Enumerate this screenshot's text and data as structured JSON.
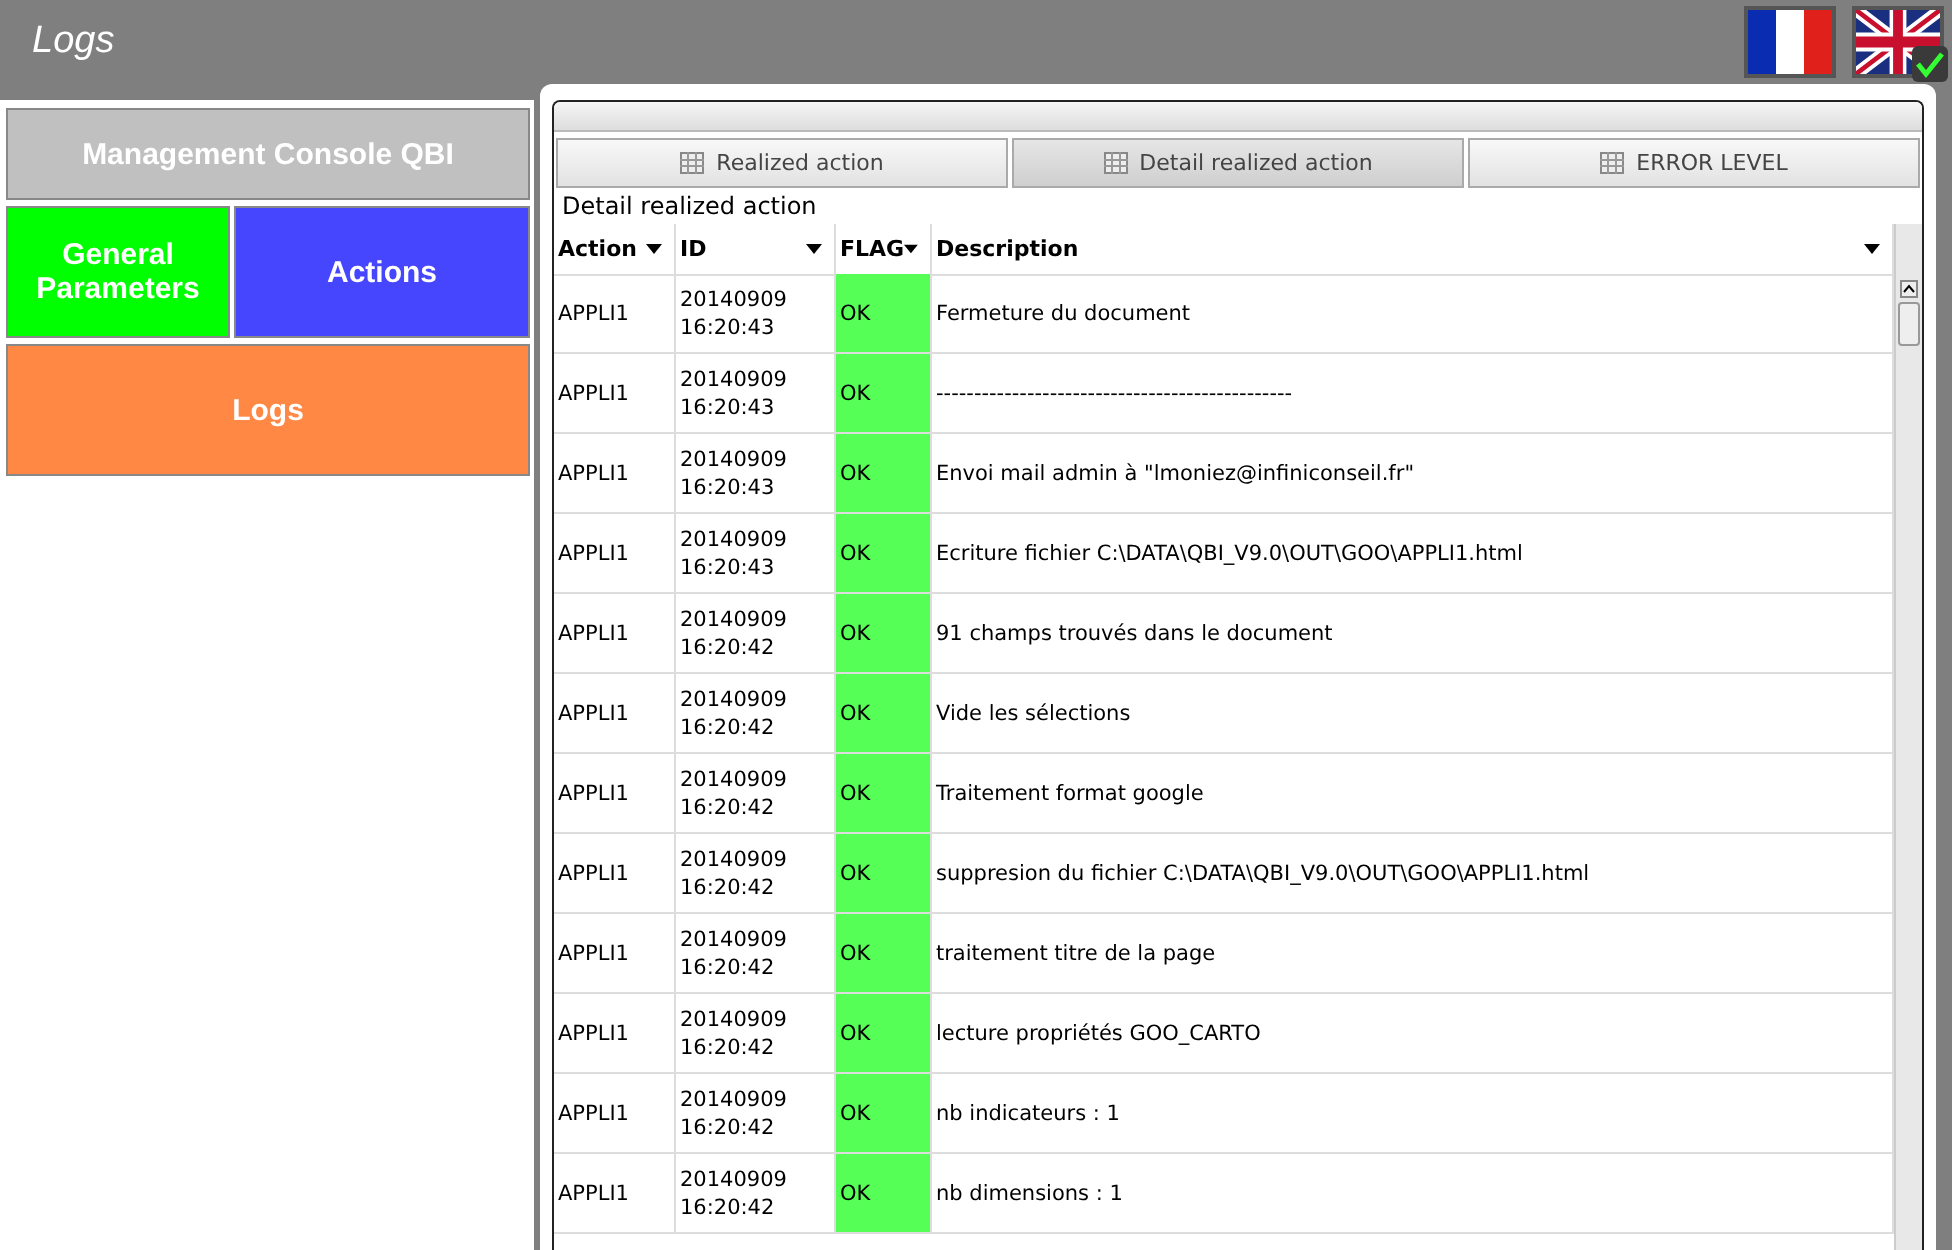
{
  "window": {
    "title": "Logs"
  },
  "languages": [
    {
      "kind": "france",
      "selected": false
    },
    {
      "kind": "uk",
      "selected": true
    }
  ],
  "nav": [
    {
      "label": "Management Console QBI",
      "color": "#c0c0c0",
      "kind": "wide"
    },
    {
      "label": "General Parameters",
      "color": "#00ff00",
      "kind": "half"
    },
    {
      "label": "Actions",
      "color": "#4646ff",
      "kind": "half"
    },
    {
      "label": "Logs",
      "color": "#ff8844",
      "kind": "wide"
    }
  ],
  "tabs": [
    {
      "label": "Realized action",
      "selected": false
    },
    {
      "label": "Detail realized action",
      "selected": true
    },
    {
      "label": "ERROR LEVEL",
      "selected": false
    }
  ],
  "table": {
    "caption": "Detail realized action",
    "columns": [
      "Action",
      "ID",
      "FLAG",
      "Description"
    ],
    "rows": [
      {
        "action": "APPLI1",
        "id": "20140909\n16:20:43",
        "flag": "OK",
        "color": "#55ff55",
        "description": "Fermeture du document"
      },
      {
        "action": "APPLI1",
        "id": "20140909\n16:20:43",
        "flag": "OK",
        "color": "#55ff55",
        "description": "-----------------------------------------------"
      },
      {
        "action": "APPLI1",
        "id": "20140909\n16:20:43",
        "flag": "OK",
        "color": "#55ff55",
        "description": "Envoi mail admin à \"lmoniez@infiniconseil.fr\""
      },
      {
        "action": "APPLI1",
        "id": "20140909\n16:20:43",
        "flag": "OK",
        "color": "#55ff55",
        "description": "Ecriture fichier C:\\DATA\\QBI_V9.0\\OUT\\GOO\\APPLI1.html"
      },
      {
        "action": "APPLI1",
        "id": "20140909\n16:20:42",
        "flag": "OK",
        "color": "#55ff55",
        "description": "91 champs trouvés dans le document"
      },
      {
        "action": "APPLI1",
        "id": "20140909\n16:20:42",
        "flag": "OK",
        "color": "#55ff55",
        "description": "Vide les sélections"
      },
      {
        "action": "APPLI1",
        "id": "20140909\n16:20:42",
        "flag": "OK",
        "color": "#55ff55",
        "description": "Traitement format google"
      },
      {
        "action": "APPLI1",
        "id": "20140909\n16:20:42",
        "flag": "OK",
        "color": "#55ff55",
        "description": "suppresion du fichier C:\\DATA\\QBI_V9.0\\OUT\\GOO\\APPLI1.html"
      },
      {
        "action": "APPLI1",
        "id": "20140909\n16:20:42",
        "flag": "OK",
        "color": "#55ff55",
        "description": "traitement titre de la page"
      },
      {
        "action": "APPLI1",
        "id": "20140909\n16:20:42",
        "flag": "OK",
        "color": "#55ff55",
        "description": "lecture propriétés GOO_CARTO"
      },
      {
        "action": "APPLI1",
        "id": "20140909\n16:20:42",
        "flag": "OK",
        "color": "#55ff55",
        "description": "nb indicateurs : 1"
      },
      {
        "action": "APPLI1",
        "id": "20140909\n16:20:42",
        "flag": "OK",
        "color": "#55ff55",
        "description": "nb dimensions : 1"
      }
    ]
  }
}
